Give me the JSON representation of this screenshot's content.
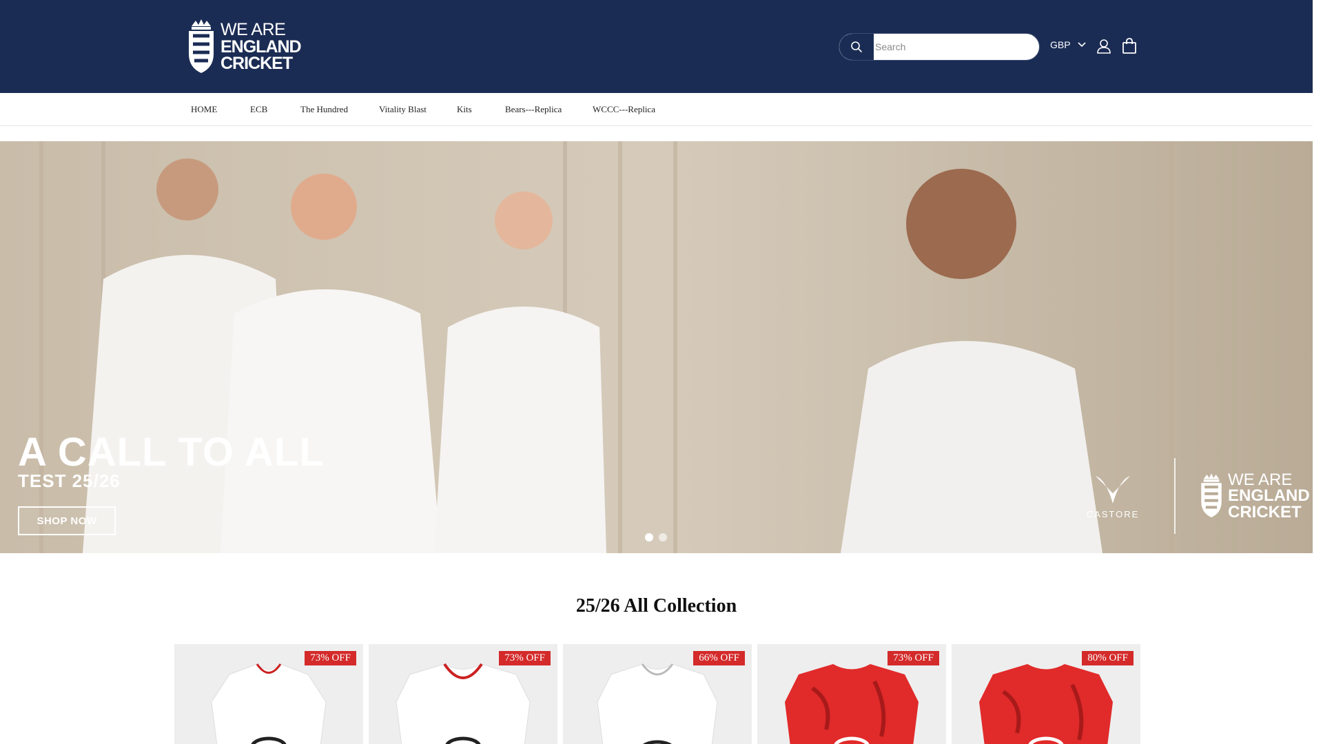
{
  "header": {
    "logo": {
      "line1": "WE ARE",
      "line2": "ENGLAND",
      "line3": "CRICKET"
    },
    "search": {
      "placeholder": "Search"
    },
    "currency": "GBP"
  },
  "nav": {
    "items": [
      {
        "label": "HOME"
      },
      {
        "label": "ECB"
      },
      {
        "label": "The Hundred"
      },
      {
        "label": "Vitality Blast"
      },
      {
        "label": "Kits"
      },
      {
        "label": "Bears---Replica"
      },
      {
        "label": "WCCC---Replica"
      }
    ]
  },
  "hero": {
    "title": "A CALL TO ALL",
    "subtitle": "TEST 25/26",
    "cta": "SHOP NOW",
    "brand_castore": "CASTORE",
    "brand_logo": {
      "line1": "WE ARE",
      "line2": "ENGLAND",
      "line3": "CRICKET"
    },
    "slides": 2,
    "active_slide": 1
  },
  "collection": {
    "title": "25/26 All Collection",
    "products": [
      {
        "badge": "73% OFF",
        "shirt_color": "#ffffff"
      },
      {
        "badge": "73% OFF",
        "shirt_color": "#ffffff"
      },
      {
        "badge": "66% OFF",
        "shirt_color": "#ffffff"
      },
      {
        "badge": "73% OFF",
        "shirt_color": "#e12a2a"
      },
      {
        "badge": "80% OFF",
        "shirt_color": "#e12a2a"
      }
    ]
  },
  "colors": {
    "header_bg": "#1b2c54",
    "badge_bg": "#d42a2a"
  }
}
